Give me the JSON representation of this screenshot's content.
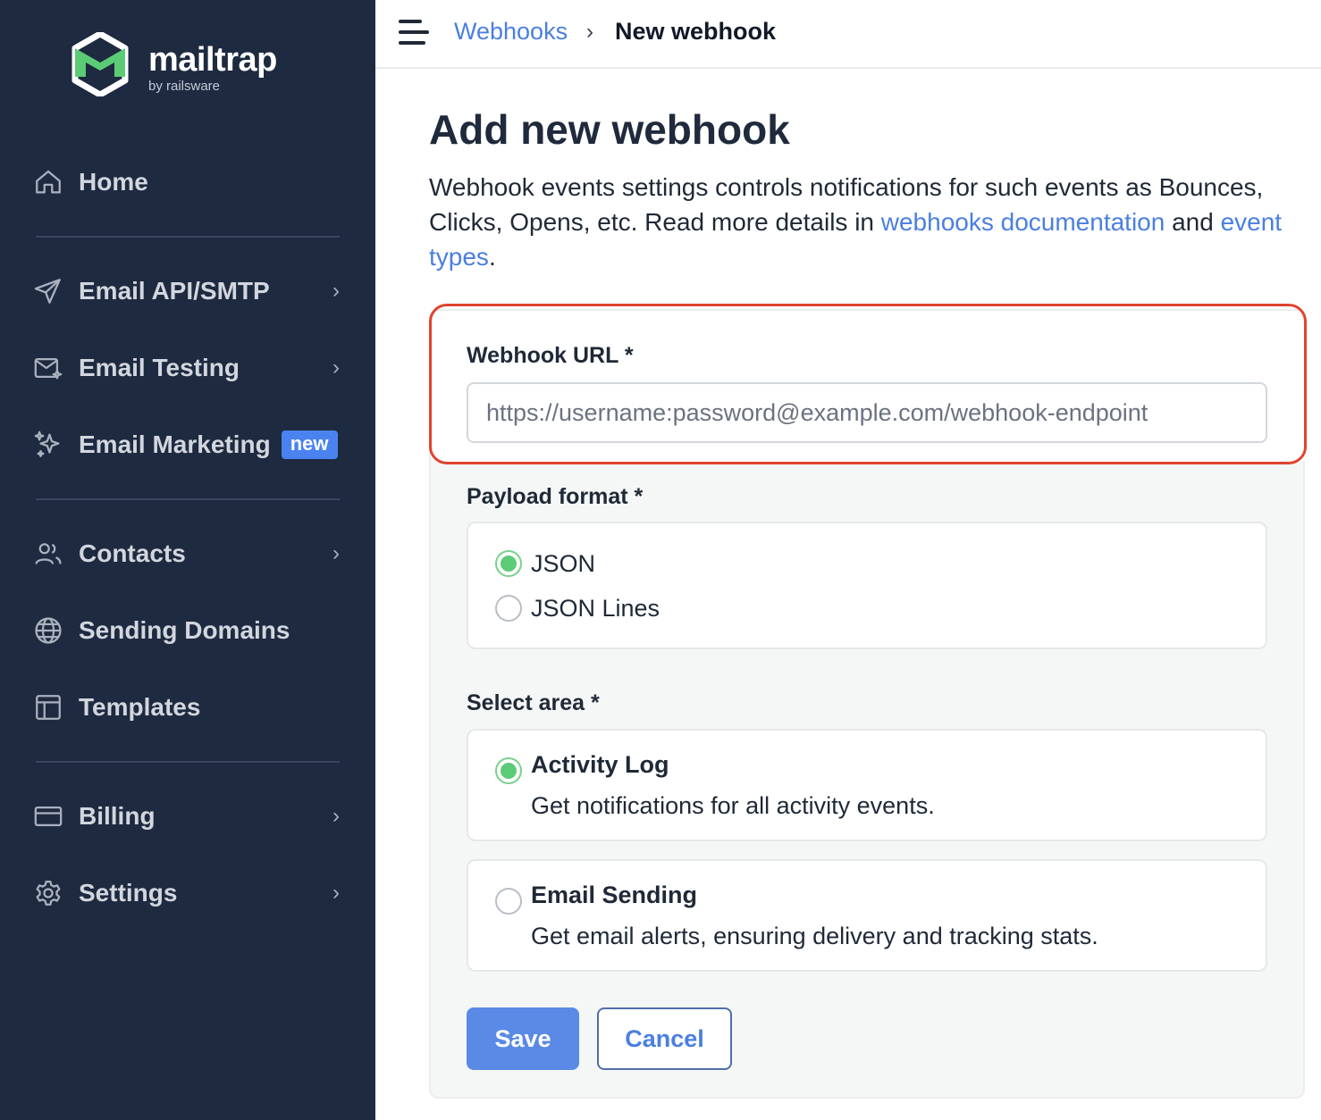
{
  "brand": {
    "name": "mailtrap",
    "by": "by railsware",
    "accent": "#5ccb76"
  },
  "sidebar": {
    "background": "#1e2a40",
    "items": [
      {
        "label": "Home",
        "icon": "home-icon",
        "chevron": false
      },
      {
        "label": "Email API/SMTP",
        "icon": "send-icon",
        "chevron": true
      },
      {
        "label": "Email Testing",
        "icon": "envelope-sparkle-icon",
        "chevron": true
      },
      {
        "label": "Email Marketing",
        "icon": "sparkles-icon",
        "chevron": false,
        "badge": "new"
      },
      {
        "label": "Contacts",
        "icon": "users-icon",
        "chevron": true
      },
      {
        "label": "Sending Domains",
        "icon": "globe-icon",
        "chevron": false
      },
      {
        "label": "Templates",
        "icon": "template-icon",
        "chevron": false
      },
      {
        "label": "Billing",
        "icon": "credit-card-icon",
        "chevron": true
      },
      {
        "label": "Settings",
        "icon": "gear-icon",
        "chevron": true
      }
    ]
  },
  "topbar": {
    "breadcrumb_link": "Webhooks",
    "separator": "›",
    "breadcrumb_current": "New webhook"
  },
  "main": {
    "title": "Add new webhook",
    "intro_text_1": "Webhook events settings controls notifications for such events as Bounces, Clicks, Opens, etc. Read more details in ",
    "intro_link_1": "webhooks documentation",
    "intro_text_2": " and ",
    "intro_link_2": "event types",
    "intro_text_3": "."
  },
  "form": {
    "url_label": "Webhook URL *",
    "url_value": "",
    "url_placeholder": "https://username:password@example.com/webhook-endpoint",
    "payload_label": "Payload format *",
    "payload_options": [
      {
        "label": "JSON",
        "checked": true
      },
      {
        "label": "JSON Lines",
        "checked": false
      }
    ],
    "area_label": "Select area *",
    "area_options": [
      {
        "title": "Activity Log",
        "description": "Get notifications for all activity events.",
        "checked": true
      },
      {
        "title": "Email Sending",
        "description": "Get email alerts, ensuring delivery and tracking stats.",
        "checked": false
      }
    ],
    "save_label": "Save",
    "cancel_label": "Cancel"
  },
  "colors": {
    "link": "#4a7fe0",
    "primary_button": "#5a8ae6",
    "highlight": "#e0432f"
  }
}
